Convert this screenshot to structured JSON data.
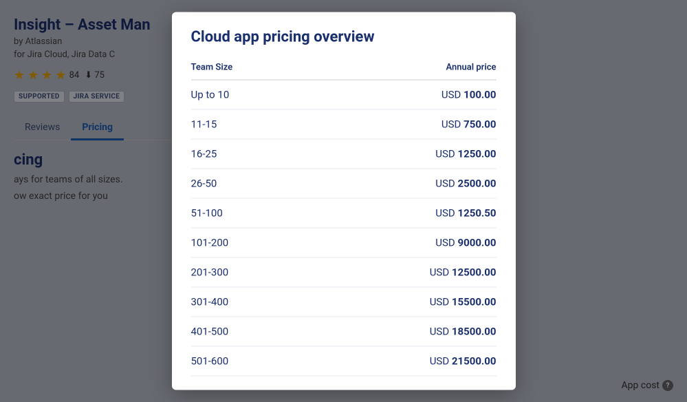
{
  "background": {
    "app_title": "Insight – Asset Man",
    "app_by": "by Atlassian",
    "app_for": "for Jira Cloud, Jira Data C",
    "review_count": "84",
    "download_count": "75",
    "badges": [
      "SUPPORTED",
      "JIRA SERVICE"
    ],
    "tabs": [
      {
        "label": "Reviews",
        "active": false
      },
      {
        "label": "Pricing",
        "active": true
      }
    ],
    "section_title": "cing",
    "section_text": "ays for teams of all sizes.",
    "exact_price_text": "ow exact price for you",
    "app_cost_label": "App cost",
    "help_icon_label": "?"
  },
  "modal": {
    "title": "Cloud app pricing overview",
    "table": {
      "col_team_size": "Team Size",
      "col_annual_price": "Annual price",
      "rows": [
        {
          "team_size": "Up to 10",
          "currency": "USD",
          "amount": "100.00"
        },
        {
          "team_size": "11-15",
          "currency": "USD",
          "amount": "750.00"
        },
        {
          "team_size": "16-25",
          "currency": "USD",
          "amount": "1250.00"
        },
        {
          "team_size": "26-50",
          "currency": "USD",
          "amount": "2500.00"
        },
        {
          "team_size": "51-100",
          "currency": "USD",
          "amount": "1250.50"
        },
        {
          "team_size": "101-200",
          "currency": "USD",
          "amount": "9000.00"
        },
        {
          "team_size": "201-300",
          "currency": "USD",
          "amount": "12500.00"
        },
        {
          "team_size": "301-400",
          "currency": "USD",
          "amount": "15500.00"
        },
        {
          "team_size": "401-500",
          "currency": "USD",
          "amount": "18500.00"
        },
        {
          "team_size": "501-600",
          "currency": "USD",
          "amount": "21500.00"
        }
      ]
    }
  }
}
